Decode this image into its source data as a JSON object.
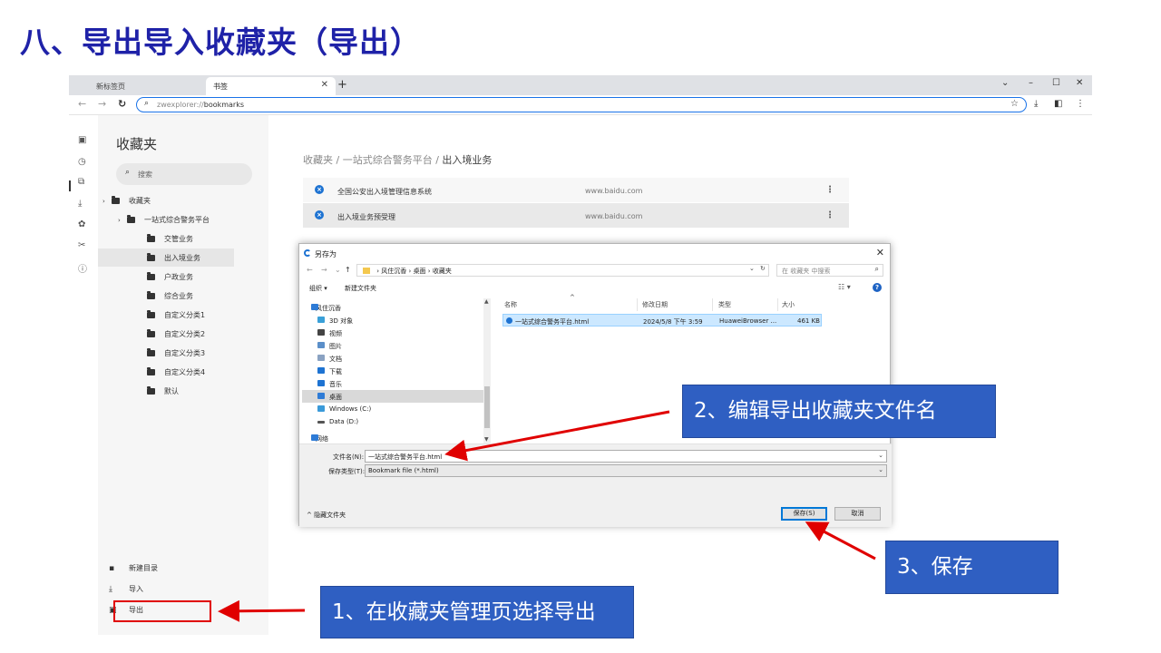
{
  "slide": {
    "title": "八、导出导入收藏夹（导出）"
  },
  "browser": {
    "tabs": [
      {
        "label": "新标签页"
      },
      {
        "label": "书签"
      }
    ],
    "new_tab": "+",
    "window_controls": {
      "minimize": "–",
      "maximize": "☐",
      "close": "✕",
      "tab_search": "⌄"
    },
    "address": {
      "scheme": "zwexplorer://",
      "path": "bookmarks"
    }
  },
  "sidebar": {
    "title": "收藏夹",
    "search_placeholder": "搜索",
    "tree": [
      {
        "label": "收藏夹",
        "level": 0,
        "expanded": true
      },
      {
        "label": "一站式综合警务平台",
        "level": 1,
        "expanded": true
      },
      {
        "label": "交管业务",
        "level": 2
      },
      {
        "label": "出入境业务",
        "level": 2,
        "selected": true
      },
      {
        "label": "户政业务",
        "level": 2
      },
      {
        "label": "综合业务",
        "level": 2
      },
      {
        "label": "自定义分类1",
        "level": 2
      },
      {
        "label": "自定义分类2",
        "level": 2
      },
      {
        "label": "自定义分类3",
        "level": 2
      },
      {
        "label": "自定义分类4",
        "level": 2
      },
      {
        "label": "默认",
        "level": 2
      }
    ],
    "actions": {
      "new_folder": "新建目录",
      "import": "导入",
      "export": "导出"
    }
  },
  "main": {
    "breadcrumb": {
      "root": "收藏夹",
      "sep1": " / ",
      "mid": "一站式综合警务平台",
      "sep2": " / ",
      "last": "出入境业务"
    },
    "bookmarks": [
      {
        "title": "全国公安出入境管理信息系统",
        "url": "www.baidu.com"
      },
      {
        "title": "出入境业务预受理",
        "url": "www.baidu.com"
      }
    ],
    "more_icon": "⋮"
  },
  "dialog": {
    "title": "另存为",
    "path": [
      "风住沉香",
      "桌面",
      "收藏夹"
    ],
    "path_sep": "›",
    "search_placeholder": "在 收藏夹 中搜索",
    "toolbar": {
      "organize": "组织 ▾",
      "new_folder": "新建文件夹",
      "help": "?"
    },
    "nav_items": [
      {
        "label": "风住沉香",
        "color": "#2e7bd6"
      },
      {
        "label": "3D 对象",
        "color": "#3aa0d8"
      },
      {
        "label": "视频",
        "color": "#444444"
      },
      {
        "label": "图片",
        "color": "#5b8fc9"
      },
      {
        "label": "文档",
        "color": "#8aa2c2"
      },
      {
        "label": "下载",
        "color": "#1e73d2"
      },
      {
        "label": "音乐",
        "color": "#1e73d2"
      },
      {
        "label": "桌面",
        "color": "#2e7bd6",
        "selected": true
      },
      {
        "label": "Windows (C:)",
        "color": "#3a9ad9"
      },
      {
        "label": "Data (D:)",
        "color": "#555555"
      },
      {
        "label": "网络",
        "color": "#2e7bd6"
      }
    ],
    "columns": {
      "name": "名称",
      "modified": "修改日期",
      "type": "类型",
      "size": "大小"
    },
    "files": [
      {
        "name": "一站式综合警务平台.html",
        "modified": "2024/5/8 下午 3:59",
        "type": "HuaweiBrowser ...",
        "size": "461 KB"
      }
    ],
    "filename_label": "文件名(N):",
    "filename_value": "一站式综合警务平台.html",
    "filetype_label": "保存类型(T):",
    "filetype_value": "Bookmark file (*.html)",
    "hide_folders": "隐藏文件夹",
    "save_button": "保存(S)",
    "cancel_button": "取消"
  },
  "annotations": {
    "step1": "1、在收藏夹管理页选择导出",
    "step2": "2、编辑导出收藏夹文件名",
    "step3": "3、保存",
    "accent": "#2f5fc2",
    "arrow_color": "#e00000"
  }
}
